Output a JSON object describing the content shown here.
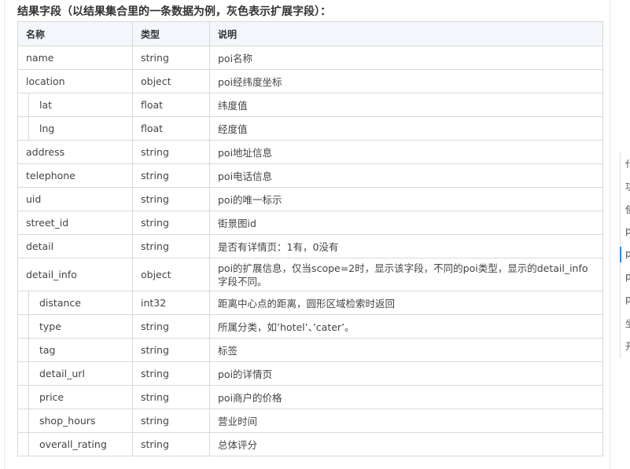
{
  "section_title": "结果字段（以结果集合里的一条数据为例，灰色表示扩展字段）：",
  "table": {
    "headers": [
      "名称",
      "类型",
      "说明"
    ],
    "rows": [
      {
        "name": "name",
        "type": "string",
        "desc": "poi名称",
        "child": false
      },
      {
        "name": "location",
        "type": "object",
        "desc": "poi经纬度坐标",
        "child": false
      },
      {
        "name": "lat",
        "type": "float",
        "desc": "纬度值",
        "child": true
      },
      {
        "name": "lng",
        "type": "float",
        "desc": "经度值",
        "child": true
      },
      {
        "name": "address",
        "type": "string",
        "desc": "poi地址信息",
        "child": false
      },
      {
        "name": "telephone",
        "type": "string",
        "desc": "poi电话信息",
        "child": false
      },
      {
        "name": "uid",
        "type": "string",
        "desc": "poi的唯一标示",
        "child": false
      },
      {
        "name": "street_id",
        "type": "string",
        "desc": "街景图id",
        "child": false
      },
      {
        "name": "detail",
        "type": "string",
        "desc": "是否有详情页：1有，0没有",
        "child": false
      },
      {
        "name": "detail_info",
        "type": "object",
        "desc": "poi的扩展信息，仅当scope=2时，显示该字段，不同的poi类型，显示的detail_info字段不同。",
        "child": false,
        "tall": true
      },
      {
        "name": "distance",
        "type": "int32",
        "desc": "距离中心点的距离，圆形区域检索时返回",
        "child": true
      },
      {
        "name": "type",
        "type": "string",
        "desc": "所属分类，如’hotel’、’cater’。",
        "child": true
      },
      {
        "name": "tag",
        "type": "string",
        "desc": "标签",
        "child": true
      },
      {
        "name": "detail_url",
        "type": "string",
        "desc": "poi的详情页",
        "child": true
      },
      {
        "name": "price",
        "type": "string",
        "desc": "poi商户的价格",
        "child": true
      },
      {
        "name": "shop_hours",
        "type": "string",
        "desc": "营业时间",
        "child": true
      },
      {
        "name": "overall_rating",
        "type": "string",
        "desc": "总体评分",
        "child": true
      }
    ]
  },
  "right_nav": {
    "items": [
      "代",
      "功",
      "使",
      "po",
      "po",
      "po",
      "po",
      "坐",
      "开"
    ],
    "active_index": 4,
    "accent_color": "#3385ff"
  }
}
